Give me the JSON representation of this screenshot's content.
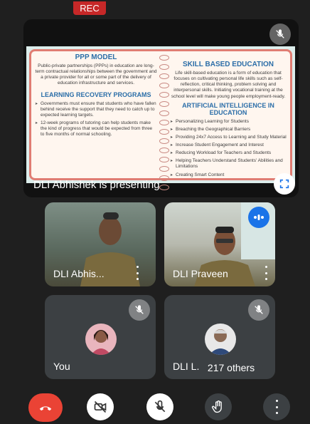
{
  "recording": {
    "label": "REC"
  },
  "presentation": {
    "presenter_label": "DLI Abhishek is presenting",
    "slide": {
      "left": {
        "title1": "PPP MODEL",
        "para1": "Public-private partnerships (PPPs) in education are long-term contractual relationships between the government and a private provider for all or some part of the delivery of education infrastructure and services.",
        "title2": "LEARNING RECOVERY PROGRAMS",
        "bullets": [
          "Governments must ensure that students who have fallen behind receive the support that they need to catch up to expected learning targets.",
          "12-week programs of tutoring can help students make the kind of progress that would be expected from three to five months of normal schooling."
        ]
      },
      "right": {
        "title1": "SKILL BASED EDUCATION",
        "para1": "Life skill-based education is a form of education that focuses on cultivating personal life skills such as self-reflection, critical thinking, problem solving and interpersonal skills. Initiating vocational training at the school level will make young people employment-ready.",
        "title2": "ARTIFICIAL INTELLIGENCE IN EDUCATION",
        "bullets": [
          "Personalizing Learning for Students",
          "Breaching the Geographical Barriers",
          "Providing 24x7 Access to Learning and Study Material",
          "Increase Student Engagement and Interest",
          "Reducing Workload for Teachers and Students",
          "Helping Teachers Understand Students' Abilities and Limitations",
          "Creating Smart Content"
        ]
      }
    }
  },
  "participants": [
    {
      "name": "DLI Abhis...",
      "muted": false
    },
    {
      "name": "DLI Praveen",
      "muted": false,
      "speaking": true
    },
    {
      "name": "You",
      "muted": true
    },
    {
      "name": "DLI L...",
      "muted": true
    }
  ],
  "others": {
    "label": "217 others"
  },
  "colors": {
    "end_call": "#ea4335",
    "control_bg": "#3c4043",
    "slide_heading": "#2b6ea8",
    "speaking_indicator": "#1a73e8"
  },
  "icons": {
    "end_call": "phone-hangup-icon",
    "camera": "camera-off-icon",
    "mic": "mic-off-icon",
    "hand": "raise-hand-icon",
    "more": "more-vert-icon"
  }
}
